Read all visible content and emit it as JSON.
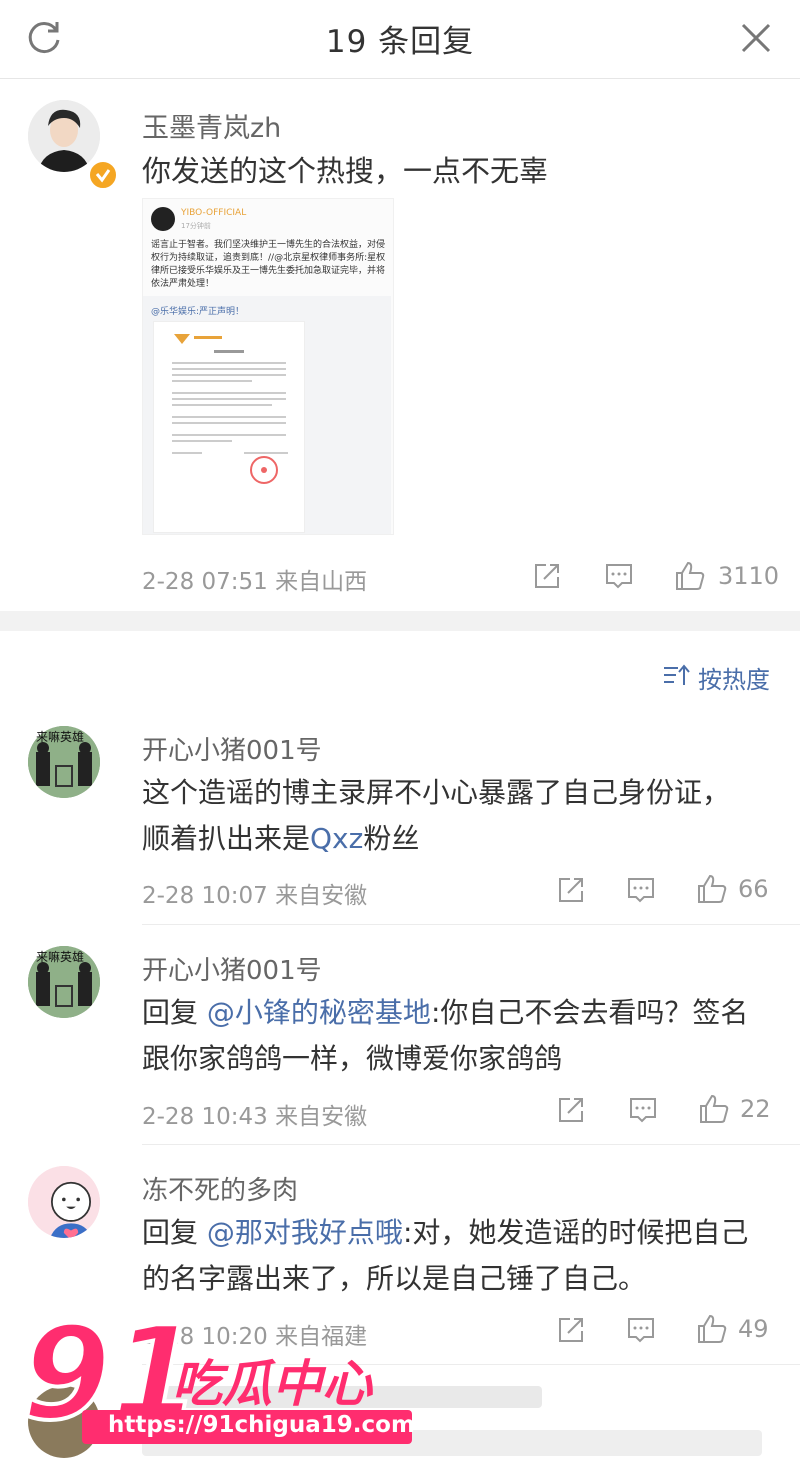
{
  "header": {
    "title": "19 条回复"
  },
  "post": {
    "username": "玉墨青岚zh",
    "text": "你发送的这个热搜，一点不无辜",
    "time": "2-28 07:51",
    "source": "来自山西",
    "likes": "3110",
    "embed": {
      "account": "YIBO-OFFICIAL",
      "time": "17分钟前",
      "text": "谣言止于智者。我们坚决维护王一博先生的合法权益，对侵权行为持续取证，追责到底！//@北京星权律师事务所:星权律所已接受乐华娱乐及王一博先生委托加急取证完毕，并将依法严肃处理！",
      "link": "@乐华娱乐:严正声明！"
    }
  },
  "sort": {
    "label": "按热度"
  },
  "comments": [
    {
      "username": "开心小猪001号",
      "avatar_text": "来嘛英雄",
      "text_before": "这个造谣的博主录屏不小心暴露了自己身份证，顺着扒出来是",
      "link": "Qxz",
      "text_after": "粉丝",
      "time": "2-28 10:07",
      "source": "来自安徽",
      "likes": "66"
    },
    {
      "username": "开心小猪001号",
      "avatar_text": "来嘛英雄",
      "reply_prefix": "回复",
      "link": "@小锋的秘密基地",
      "text_after": ":你自己不会去看吗？签名跟你家鸽鸽一样，微博爱你家鸽鸽",
      "time": "2-28 10:43",
      "source": "来自安徽",
      "likes": "22"
    },
    {
      "username": "冻不死的多肉",
      "reply_prefix": "回复",
      "link": "@那对我好点哦",
      "text_after": ":对，她发造谣的时候把自己的名字露出来了，所以是自己锤了自己。",
      "time": "2-28 10:20",
      "source": "来自福建",
      "likes": "49"
    }
  ],
  "watermark": {
    "brand": "91吃瓜中心",
    "url": "https://91chigua19.com"
  },
  "colors": {
    "link": "#4a6ea9",
    "verified": "#f5a623",
    "watermark": "#ff2d6f"
  }
}
